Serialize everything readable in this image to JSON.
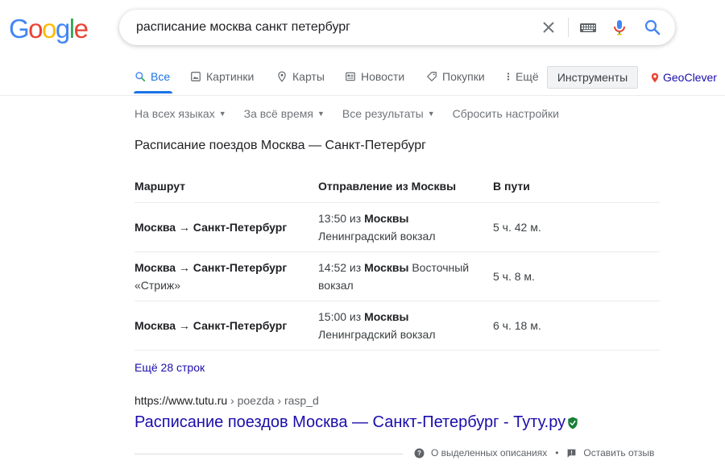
{
  "logo": {
    "letters": [
      "G",
      "o",
      "o",
      "g",
      "l",
      "e"
    ],
    "colors": [
      "#4285F4",
      "#EA4335",
      "#FBBC05",
      "#4285F4",
      "#34A853",
      "#EA4335"
    ]
  },
  "search": {
    "query": "расписание москва санкт петербург",
    "icons": [
      "close-icon",
      "keyboard-icon",
      "mic-icon",
      "search-icon"
    ]
  },
  "tabs": [
    {
      "label": "Все",
      "icon": "search-icon"
    },
    {
      "label": "Картинки",
      "icon": "image-icon"
    },
    {
      "label": "Карты",
      "icon": "map-pin-icon"
    },
    {
      "label": "Новости",
      "icon": "news-icon"
    },
    {
      "label": "Покупки",
      "icon": "tag-icon"
    },
    {
      "label": "Ещё",
      "icon": "more-vert-icon"
    }
  ],
  "tools_label": "Инструменты",
  "extension_label": "GeoClever",
  "filters": [
    "На всех языках",
    "За всё время",
    "Все результаты",
    "Сбросить настройки"
  ],
  "card": {
    "title": "Расписание поездов Москва — Санкт-Петербург",
    "headers": [
      "Маршрут",
      "Отправление из Москвы",
      "В пути"
    ],
    "rows": [
      {
        "route": "Москва → Санкт-Петербург",
        "route_sub": "",
        "time": "13:50 из",
        "city": "Москвы",
        "station": "Ленинградский вокзал",
        "duration": "5 ч. 42 м."
      },
      {
        "route": "Москва → Санкт-Петербург",
        "route_sub": "«Стриж»",
        "time": "14:52 из",
        "city": "Москвы",
        "station": "Восточный вокзал",
        "duration": "5 ч. 8 м."
      },
      {
        "route": "Москва → Санкт-Петербург",
        "route_sub": "",
        "time": "15:00 из",
        "city": "Москвы",
        "station": "Ленинградский вокзал",
        "duration": "6 ч. 18 м."
      }
    ],
    "more_label": "Ещё 28 строк"
  },
  "result": {
    "domain": "https://www.tutu.ru",
    "path": " › poezda › rasp_d",
    "title": "Расписание поездов Москва — Санкт-Петербург - Туту.ру"
  },
  "footer": {
    "about": "О выделенных описаниях",
    "dot": "•",
    "feedback": "Оставить отзыв"
  }
}
